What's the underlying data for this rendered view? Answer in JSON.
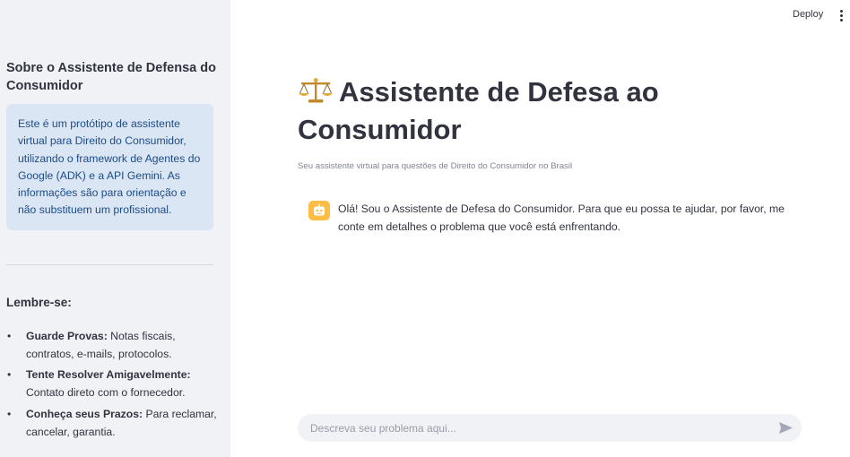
{
  "sidebar": {
    "title": "Sobre o Assistente de Defensa do Consumidor",
    "info": "Este é um protótipo de assistente virtual para Direito do Consumidor, utilizando o framework de Agentes do Google (ADK) e a API Gemini. As informações são para orientação e não substituem um profissional.",
    "remember_title": "Lembre-se:",
    "tips": [
      {
        "label": "Guarde Provas:",
        "text": "Notas fiscais, contratos, e-mails, protocolos."
      },
      {
        "label": "Tente Resolver Amigavelmente:",
        "text": "Contato direto com o fornecedor."
      },
      {
        "label": "Conheça seus Prazos:",
        "text": "Para reclamar, cancelar, garantia."
      }
    ]
  },
  "header": {
    "deploy_label": "Deploy",
    "menu_icon": "vertical-dots-icon"
  },
  "main": {
    "title_icon": "balance-scale-icon",
    "title": "Assistente de Defesa ao Consumidor",
    "subtitle": "Seu assistente virtual para questões de Direito do Consumidor no Brasil",
    "messages": [
      {
        "role": "assistant",
        "avatar_icon": "robot-icon",
        "text": "Olá! Sou o Assistente de Defesa do Consumidor. Para que eu possa te ajudar, por favor, me conte em detalhes o problema que você está enfrentando."
      }
    ],
    "chat_input": {
      "placeholder": "Descreva seu problema aqui...",
      "value": "",
      "send_icon": "send-icon"
    }
  },
  "colors": {
    "sidebar_bg": "#f0f2f6",
    "info_bg": "#dbe6f4",
    "info_text": "#1c4b86",
    "avatar_bg": "#ffbd45",
    "text": "#31333f"
  }
}
